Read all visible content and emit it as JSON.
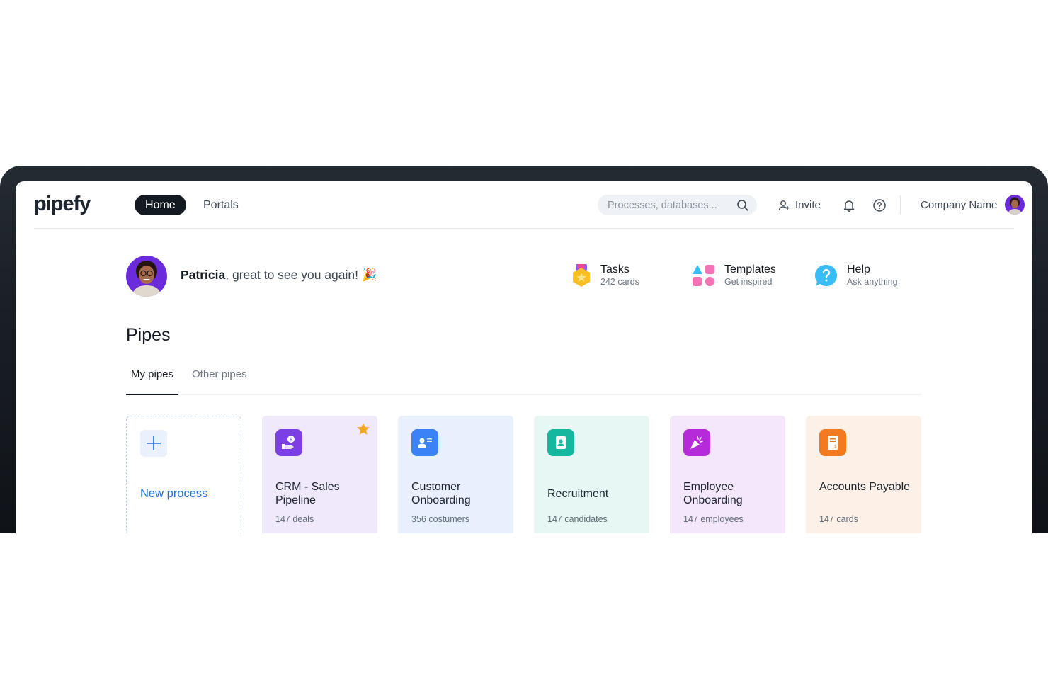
{
  "topbar": {
    "logo": "pipefy",
    "nav": {
      "home": "Home",
      "portals": "Portals"
    },
    "search_placeholder": "Processes, databases...",
    "invite_label": "Invite",
    "company_name": "Company Name"
  },
  "greeting": {
    "name": "Patricia",
    "message": ", great to see you again! 🎉"
  },
  "shortcuts": [
    {
      "title": "Tasks",
      "subtitle": "242 cards"
    },
    {
      "title": "Templates",
      "subtitle": "Get inspired"
    },
    {
      "title": "Help",
      "subtitle": "Ask anything"
    }
  ],
  "pipes": {
    "title": "Pipes",
    "tabs": [
      "My pipes",
      "Other pipes"
    ],
    "new_process": "New process",
    "cards": [
      {
        "title": "CRM - Sales Pipeline",
        "subtitle": "147 deals",
        "bg": "#efe9fb",
        "icon_color": "#7b3fe4",
        "starred": true
      },
      {
        "title": "Customer Onboarding",
        "subtitle": "356 costumers",
        "bg": "#e9f0fd",
        "icon_color": "#3b82f6",
        "starred": false
      },
      {
        "title": "Recruitment",
        "subtitle": "147 candidates",
        "bg": "#e6f7f4",
        "icon_color": "#15b79e",
        "starred": false
      },
      {
        "title": "Employee Onboarding",
        "subtitle": "147 employees",
        "bg": "#f4e7fb",
        "icon_color": "#b52ad9",
        "starred": false
      },
      {
        "title": "Accounts Payable",
        "subtitle": "147 cards",
        "bg": "#fdf0e6",
        "icon_color": "#f47a1f",
        "starred": false
      }
    ]
  }
}
